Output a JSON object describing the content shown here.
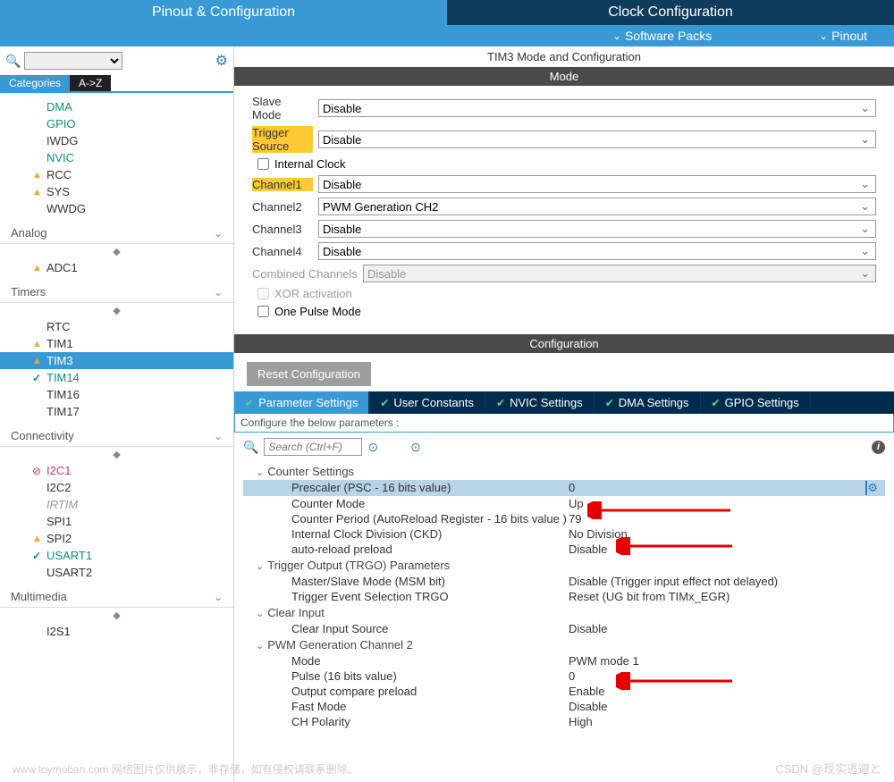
{
  "topTabs": {
    "pinout": "Pinout & Configuration",
    "clock": "Clock Configuration"
  },
  "subBar": {
    "packs": "Software Packs",
    "pinout": "Pinout"
  },
  "catTabs": {
    "categories": "Categories",
    "az": "A->Z"
  },
  "tree": {
    "systemCore": {
      "items": [
        {
          "icon": "",
          "label": "DMA",
          "cls": "teal"
        },
        {
          "icon": "",
          "label": "GPIO",
          "cls": "teal"
        },
        {
          "icon": "",
          "label": "IWDG",
          "cls": "black"
        },
        {
          "icon": "",
          "label": "NVIC",
          "cls": "teal"
        },
        {
          "icon": "warn",
          "label": "RCC",
          "cls": "black"
        },
        {
          "icon": "warn",
          "label": "SYS",
          "cls": "black"
        },
        {
          "icon": "",
          "label": "WWDG",
          "cls": "black"
        }
      ]
    },
    "analog": {
      "title": "Analog",
      "items": [
        {
          "icon": "warn",
          "label": "ADC1",
          "cls": "black"
        }
      ]
    },
    "timers": {
      "title": "Timers",
      "items": [
        {
          "icon": "",
          "label": "RTC",
          "cls": "black"
        },
        {
          "icon": "warn",
          "label": "TIM1",
          "cls": "black"
        },
        {
          "icon": "warn",
          "label": "TIM3",
          "cls": "selected"
        },
        {
          "icon": "check",
          "label": "TIM14",
          "cls": "teal"
        },
        {
          "icon": "",
          "label": "TIM16",
          "cls": "black"
        },
        {
          "icon": "",
          "label": "TIM17",
          "cls": "black"
        }
      ]
    },
    "connectivity": {
      "title": "Connectivity",
      "items": [
        {
          "icon": "block",
          "label": "I2C1",
          "cls": "magenta"
        },
        {
          "icon": "",
          "label": "I2C2",
          "cls": "black"
        },
        {
          "icon": "",
          "label": "IRTIM",
          "cls": "gray"
        },
        {
          "icon": "",
          "label": "SPI1",
          "cls": "black"
        },
        {
          "icon": "warn",
          "label": "SPI2",
          "cls": "black"
        },
        {
          "icon": "check",
          "label": "USART1",
          "cls": "teal"
        },
        {
          "icon": "",
          "label": "USART2",
          "cls": "black"
        }
      ]
    },
    "multimedia": {
      "title": "Multimedia",
      "items": [
        {
          "icon": "",
          "label": "I2S1",
          "cls": "black"
        }
      ]
    }
  },
  "panel": {
    "title": "TIM3 Mode and Configuration",
    "modeHeader": "Mode",
    "slaveMode": {
      "label": "Slave Mode",
      "value": "Disable"
    },
    "triggerSource": {
      "label": "Trigger Source",
      "value": "Disable"
    },
    "internalClock": "Internal Clock",
    "ch1": {
      "label": "Channel1",
      "value": "Disable"
    },
    "ch2": {
      "label": "Channel2",
      "value": "PWM Generation CH2"
    },
    "ch3": {
      "label": "Channel3",
      "value": "Disable"
    },
    "ch4": {
      "label": "Channel4",
      "value": "Disable"
    },
    "combined": {
      "label": "Combined Channels",
      "value": "Disable"
    },
    "xor": "XOR activation",
    "onePulse": "One Pulse Mode"
  },
  "config": {
    "header": "Configuration",
    "reset": "Reset Configuration",
    "tabs": {
      "param": "Parameter Settings",
      "user": "User Constants",
      "nvic": "NVIC Settings",
      "dma": "DMA Settings",
      "gpio": "GPIO Settings"
    },
    "sub": "Configure the below parameters :",
    "searchPh": "Search (Ctrl+F)",
    "groups": {
      "counter": "Counter Settings",
      "trgo": "Trigger Output (TRGO) Parameters",
      "clear": "Clear Input",
      "pwm2": "PWM Generation Channel 2"
    },
    "params": {
      "prescaler": {
        "name": "Prescaler (PSC - 16 bits value)",
        "val": "0"
      },
      "counterMode": {
        "name": "Counter Mode",
        "val": "Up"
      },
      "period": {
        "name": "Counter Period (AutoReload Register - 16 bits value )",
        "val": "79"
      },
      "ckd": {
        "name": "Internal Clock Division (CKD)",
        "val": "No Division"
      },
      "arp": {
        "name": "auto-reload preload",
        "val": "Disable"
      },
      "msm": {
        "name": "Master/Slave Mode (MSM bit)",
        "val": "Disable (Trigger input effect not delayed)"
      },
      "trgoSel": {
        "name": "Trigger Event Selection TRGO",
        "val": "Reset (UG bit from TIMx_EGR)"
      },
      "clearSrc": {
        "name": "Clear Input Source",
        "val": "Disable"
      },
      "pwmMode": {
        "name": "Mode",
        "val": "PWM mode 1"
      },
      "pulse": {
        "name": "Pulse (16 bits value)",
        "val": "0"
      },
      "ocp": {
        "name": "Output compare preload",
        "val": "Enable"
      },
      "fast": {
        "name": "Fast Mode",
        "val": "Disable"
      },
      "pol": {
        "name": "CH Polarity",
        "val": "High"
      }
    }
  },
  "watermark": "www.toymoban.com 网络图片仅供展示，非存储，如有侵权请联系删除。",
  "watermark2": "CSDN @现实逃避と"
}
